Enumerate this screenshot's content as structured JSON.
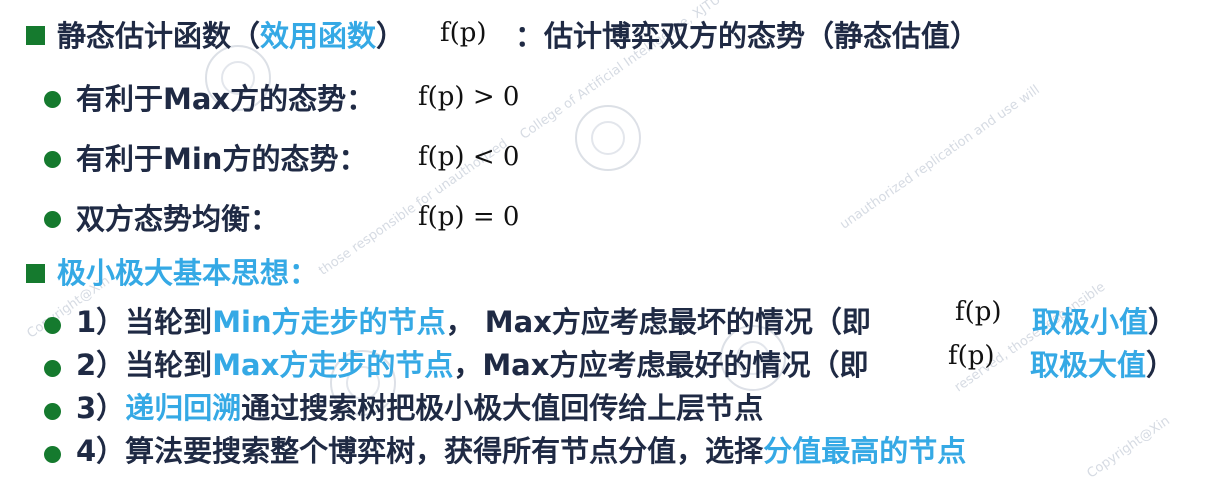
{
  "heading1": {
    "prefix": "静态估计函数（",
    "highlight": "效用函数",
    "suffix": "）",
    "formula": "f(p)",
    "tail": "：估计博弈双方的态势（静态估值）"
  },
  "bullets": [
    {
      "label": "有利于Max方的态势：",
      "formula": "f(p) > 0"
    },
    {
      "label": "有利于Min方的态势：",
      "formula": "f(p) < 0"
    },
    {
      "label": "双方态势均衡：",
      "formula": "f(p) = 0"
    }
  ],
  "heading2": {
    "text": "极小极大基本思想："
  },
  "steps": [
    {
      "prefix": "1）当轮到",
      "highlight": "Min方走步的节点",
      "middle": "， Max方应考虑最坏的情况（即",
      "formula": "f(p)",
      "tail": "取极小值",
      "close": "）"
    },
    {
      "prefix": "2）当轮到",
      "highlight": "Max方走步的节点",
      "middle": "，Max方应考虑最好的情况（即",
      "formula": "f(p)",
      "tail": "取极大值",
      "close": "）"
    },
    {
      "prefix": "3）",
      "highlight": "递归回溯",
      "middle": "通过搜索树把极小极大值回传给上层节点",
      "formula": "",
      "tail": "",
      "close": ""
    },
    {
      "prefix": "4）算法要搜索整个博弈树，获得所有节点分值，选择",
      "highlight": "分值最高的节点",
      "middle": "",
      "formula": "",
      "tail": "",
      "close": ""
    }
  ],
  "colors": {
    "bullet": "#157a2e",
    "highlight": "#35a9e5",
    "text": "#1f2a44"
  }
}
